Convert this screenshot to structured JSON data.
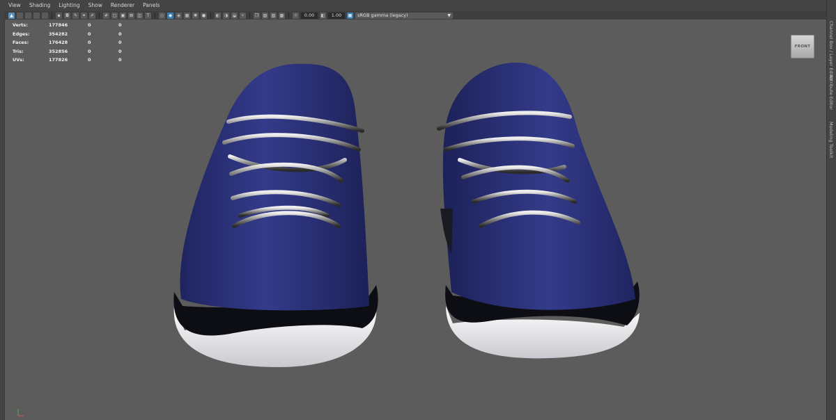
{
  "menu": [
    "View",
    "Shading",
    "Lighting",
    "Show",
    "Renderer",
    "Panels"
  ],
  "toolbar": {
    "exposure": "0.00",
    "gamma": "1.00",
    "colorspace": "sRGB gamma (legacy)"
  },
  "hud": [
    {
      "label": "Verts:",
      "values": [
        "177846",
        "0",
        "0"
      ]
    },
    {
      "label": "Edges:",
      "values": [
        "354282",
        "0",
        "0"
      ]
    },
    {
      "label": "Faces:",
      "values": [
        "176428",
        "0",
        "0"
      ]
    },
    {
      "label": "Tris:",
      "values": [
        "352856",
        "0",
        "0"
      ]
    },
    {
      "label": "UVs:",
      "values": [
        "177826",
        "0",
        "0"
      ]
    }
  ],
  "viewcube": "FRONT",
  "right_tabs": [
    "Channel Box / Layer Editor",
    "Attribute Editor",
    "Modeling Toolkit"
  ],
  "colors": {
    "viewport_bg": "#5c5c5c",
    "shoe_upper": "#2a3175",
    "sole": "#ffffff",
    "lace": "#c8c8c8"
  }
}
